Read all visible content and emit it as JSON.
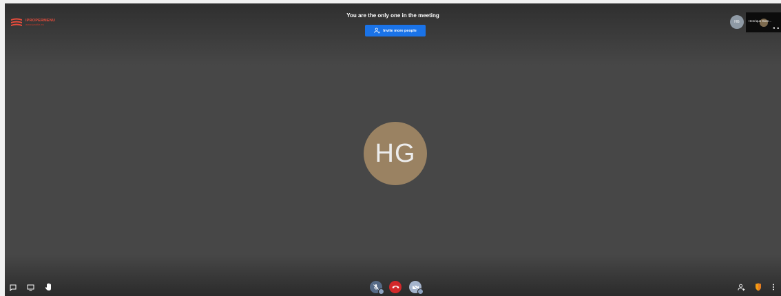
{
  "logo": {
    "name": "IPROPERMENU",
    "tagline": "www.iprofile.eu"
  },
  "meeting": {
    "notice": "You are the only one in the meeting",
    "invite_label": "Invite more people"
  },
  "participants": {
    "avatar_initials": "HG",
    "local_avatar_initials": "HG",
    "thumbnail_name": "Henrique Gom..."
  },
  "colors": {
    "background": "#474747",
    "invite": "#1a73e8",
    "hangup": "#d3282a",
    "avatar": "#9a8262"
  },
  "toolbar": {
    "left": [
      "chat-icon",
      "screen-share-icon",
      "raise-hand-icon"
    ],
    "center": [
      "microphone-muted-icon",
      "hangup-icon",
      "camera-off-icon"
    ],
    "right": [
      "invite-people-icon",
      "security-shield-icon",
      "more-options-icon"
    ]
  }
}
